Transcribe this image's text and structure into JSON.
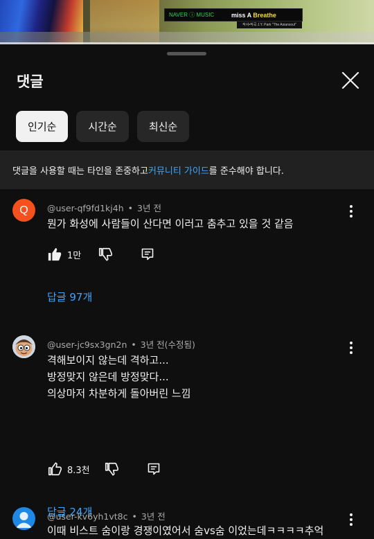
{
  "video": {
    "banner_brand": "NAVER ⓘ MUSIC",
    "banner_artist": "miss A ",
    "banner_song": "Breathe",
    "credits": "작사•작곡 J.Y. Park \"The Asiansoul\""
  },
  "sheet": {
    "title": "댓글",
    "chips": [
      "인기순",
      "시간순",
      "최신순"
    ],
    "notice": {
      "before": "댓글을 사용할 때는 타인을 존중하고 ",
      "link": "커뮤니티 가이드",
      "after": "를 준수해야 합니다."
    }
  },
  "comments": [
    {
      "avatar_letter": "Q",
      "avatar_color": "#f4511e",
      "user": "@user-qf9fd1kj4h",
      "time": "3년 전",
      "lines": [
        "뭔가 화성에 사람들이 산다면 이러고 춤추고 있을 것 같음"
      ],
      "likes": "1만",
      "replies": "답글 97개"
    },
    {
      "avatar_icon": "cartoon-face",
      "user": "@user-jc9sx3gn2n",
      "time": "3년 전(수정됨)",
      "lines": [
        "격해보이지 않는데 격하고...",
        "방정맞지 않은데 방정맞다...",
        "의상마저 차분하게 돌아버린 느낌"
      ],
      "likes": "8.3천",
      "replies": "답글 24개"
    },
    {
      "avatar_icon": "default-person",
      "avatar_color": "#1e88e5",
      "user": "@user-kv6yh1vt8c",
      "time": "3년 전",
      "lines": [
        "이때 비스트 숨이랑 경쟁이였어서 숨vs숨 이었는데ㅋㅋㅋㅋ추억"
      ]
    }
  ]
}
